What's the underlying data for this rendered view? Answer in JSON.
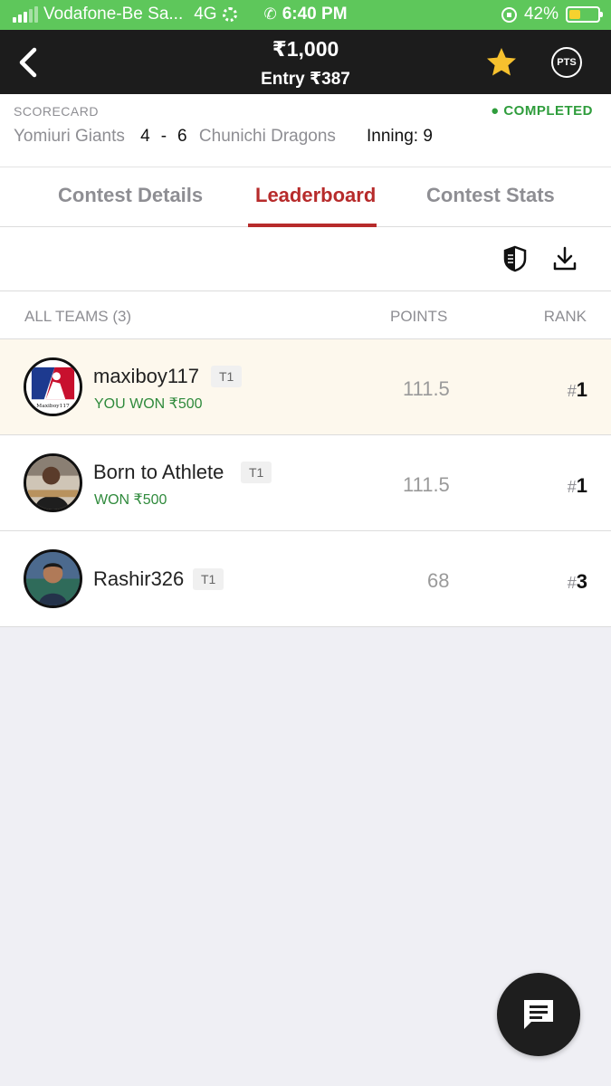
{
  "status_bar": {
    "carrier": "Vodafone-Be Sa...",
    "network": "4G",
    "time": "6:40 PM",
    "battery": "42%"
  },
  "header": {
    "prize": "₹1,000",
    "entry": "Entry ₹387",
    "pts_label": "PTS"
  },
  "scorecard": {
    "label": "SCORECARD",
    "status": "● COMPLETED",
    "team1": "Yomiuri Giants",
    "score1": "4",
    "separator": "-",
    "score2": "6",
    "team2": "Chunichi Dragons",
    "inning": "Inning: 9"
  },
  "tabs": [
    {
      "label": "Contest Details",
      "active": false
    },
    {
      "label": "Leaderboard",
      "active": true
    },
    {
      "label": "Contest Stats",
      "active": false
    }
  ],
  "table_header": {
    "teams": "ALL TEAMS (3)",
    "points": "POINTS",
    "rank": "RANK"
  },
  "rows": [
    {
      "name": "maxiboy117",
      "team": "T1",
      "won": "YOU WON ₹500",
      "points": "111.5",
      "rank_hash": "#",
      "rank": "1",
      "avatar_caption": "Maxiboy117"
    },
    {
      "name": "Born to Athlete",
      "team": "T1",
      "won": "WON ₹500",
      "points": "111.5",
      "rank_hash": "#",
      "rank": "1"
    },
    {
      "name": "Rashir326",
      "team": "T1",
      "won": "",
      "points": "68",
      "rank_hash": "#",
      "rank": "3"
    }
  ],
  "colors": {
    "status_bar": "#5ec75b",
    "header": "#1c1c1c",
    "accent": "#b72b2b",
    "won_text": "#2f8a3c",
    "star": "#f6c12e"
  }
}
